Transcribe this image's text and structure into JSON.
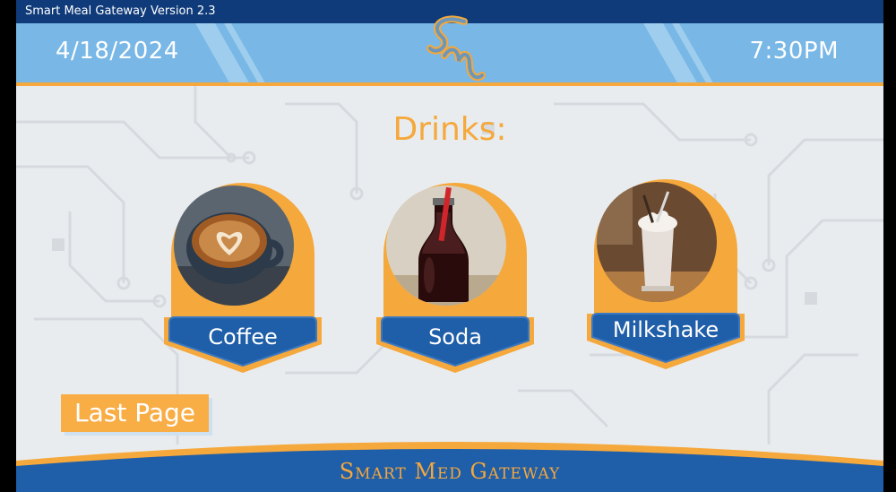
{
  "app": {
    "version_title": "Smart Meal Gateway Version 2.3"
  },
  "header": {
    "date": "4/18/2024",
    "time": "7:30PM",
    "logo_letters": "SM"
  },
  "main": {
    "section_title": "Drinks:",
    "items": [
      {
        "label": "Coffee",
        "image": "coffee-cup-latte-art"
      },
      {
        "label": "Soda",
        "image": "cola-bottle-with-straw"
      },
      {
        "label": "Milkshake",
        "image": "milkshake-glass"
      }
    ]
  },
  "nav": {
    "last_page_label": "Last Page"
  },
  "footer": {
    "brand": "Smart Med Gateway"
  },
  "colors": {
    "accent_orange": "#f5a83b",
    "navy": "#1f5ea8",
    "sky": "#78b7e6",
    "background": "#e9ecef"
  }
}
